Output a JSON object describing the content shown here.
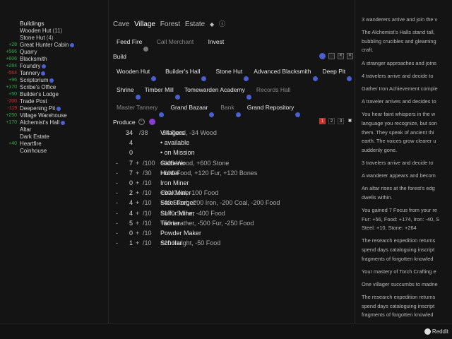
{
  "left_rates": [
    {
      "text": "+28",
      "cls": "pos"
    },
    {
      "text": "+566",
      "cls": "pos"
    },
    {
      "text": "+606",
      "cls": "pos"
    },
    {
      "text": "+284",
      "cls": "pos"
    },
    {
      "text": "-564",
      "cls": "neg"
    },
    {
      "text": "+96",
      "cls": "pos"
    },
    {
      "text": "+170",
      "cls": "pos"
    },
    {
      "text": "+50",
      "cls": "pos"
    },
    {
      "text": "-200",
      "cls": "neg"
    },
    {
      "text": "-119",
      "cls": "neg"
    },
    {
      "text": "+250",
      "cls": "pos"
    },
    {
      "text": "+170",
      "cls": "pos"
    },
    {
      "text": "",
      "cls": "pos"
    },
    {
      "text": "",
      "cls": "pos"
    },
    {
      "text": "+40",
      "cls": "pos"
    }
  ],
  "buildings": {
    "title": "Buildings",
    "items": [
      {
        "label": "Wooden Hut",
        "count": "(11)",
        "badge": false
      },
      {
        "label": "Stone Hut",
        "count": "(4)",
        "badge": false
      },
      {
        "label": "Great Hunter Cabin",
        "count": "",
        "badge": true
      },
      {
        "label": "Quarry",
        "count": "",
        "badge": false
      },
      {
        "label": "Blacksmith",
        "count": "",
        "badge": false
      },
      {
        "label": "Foundry",
        "count": "",
        "badge": true
      },
      {
        "label": "Tannery",
        "count": "",
        "badge": true
      },
      {
        "label": "Scriptorium",
        "count": "",
        "badge": true
      },
      {
        "label": "Scribe's Office",
        "count": "",
        "badge": false
      },
      {
        "label": "Builder's Lodge",
        "count": "",
        "badge": false
      },
      {
        "label": "Trade Post",
        "count": "",
        "badge": false
      },
      {
        "label": "Deepening Pit",
        "count": "",
        "badge": true
      },
      {
        "label": "Village Warehouse",
        "count": "",
        "badge": false
      },
      {
        "label": "Alchemist's Hall",
        "count": "",
        "badge": true
      },
      {
        "label": "Altar",
        "count": "",
        "badge": false
      },
      {
        "label": "Dark Estate",
        "count": "",
        "badge": false
      },
      {
        "label": "Heartfire",
        "count": "",
        "badge": false
      },
      {
        "label": "Coinhouse",
        "count": "",
        "badge": false
      }
    ]
  },
  "tabs": [
    "Cave",
    "Village",
    "Forest",
    "Estate"
  ],
  "active_tab": "Village",
  "actions": {
    "feed_fire": "Feed Fire",
    "call_merchant": "Call Merchant",
    "invest": "Invest"
  },
  "build": {
    "title": "Build",
    "row1": [
      "Wooden Hut",
      "Builder's Hall",
      "Stone Hut",
      "Advanced Blacksmith",
      "Deep Pit"
    ],
    "row2": [
      "Shrine",
      "Timber Mill",
      "Tomewarden Academy",
      "Records Hall"
    ],
    "row3": [
      "Master Tannery",
      "Grand Bazaar",
      "Bank",
      "Grand Repository"
    ]
  },
  "produce": {
    "title": "Produce",
    "pages": [
      "1",
      "2",
      "3"
    ],
    "villagers": {
      "count": "34",
      "cap": "/38",
      "label": "Villagers",
      "effect": "-34 Food, -34 Wood"
    },
    "available": {
      "count": "4",
      "label": "• available"
    },
    "mission": {
      "count": "0",
      "label": "• on Mission"
    },
    "jobs": [
      {
        "num": "7",
        "cap": "/100",
        "name": "Gatherer",
        "effect": "+600 Wood, +600 Stone"
      },
      {
        "num": "7",
        "cap": "/30",
        "name": "Hunter",
        "effect": "+600 Food, +120 Fur, +120 Bones"
      },
      {
        "num": "0",
        "cap": "/10",
        "name": "Iron Miner",
        "effect": ""
      },
      {
        "num": "2",
        "cap": "/10",
        "name": "Coal Miner",
        "effect": "+90 Coal, -100 Food"
      },
      {
        "num": "4",
        "cap": "/10",
        "name": "Steel Forger",
        "effect": "+40 Steel, -200 Iron, -200 Coal, -200 Food"
      },
      {
        "num": "4",
        "cap": "/10",
        "name": "Sulfur Miner",
        "effect": "+170 Sulfur, -400 Food"
      },
      {
        "num": "5",
        "cap": "/10",
        "name": "Tanner",
        "effect": "+50 Leather, -500 Fur, -250 Food"
      },
      {
        "num": "0",
        "cap": "/10",
        "name": "Powder Maker",
        "effect": ""
      },
      {
        "num": "1",
        "cap": "/10",
        "name": "Scholar",
        "effect": "+20 Insight, -50 Food"
      }
    ]
  },
  "log": [
    [
      "3 wanderers arrive and join the v"
    ],
    [
      "The Alchemist's Halls stand tall,",
      "bubbling crucibles and gleaming",
      "craft."
    ],
    [
      "A stranger approaches and joins"
    ],
    [
      "4 travelers arrive and decide to"
    ],
    [
      "Gather Iron Achievement comple"
    ],
    [
      "A traveler arrives and decides to"
    ],
    [
      "You hear faint whispers in the w",
      "language you recognize, but son",
      "them. They speak of ancient thi",
      "earth. The voices grow clearer u",
      "suddenly gone."
    ],
    [
      "3 travelers arrive and decide to"
    ],
    [
      "A wanderer appears and becom"
    ],
    [
      "An altar rises at the forest's edg",
      "dwells within."
    ],
    [
      "You gained 7 Focus from your re",
      "Fur: +56, Food: +174, Iron: -40, S",
      "Steel: +10, Stone: +264"
    ],
    [
      "The research expedition returns",
      "spend days cataloguing inscript",
      "fragments of forgotten knowled"
    ],
    [
      "Your mastery of Torch Crafting e"
    ],
    [
      "One villager succumbs to madne"
    ],
    [
      "The research expedition returns",
      "spend days cataloguing inscript",
      "fragments of forgotten knowled"
    ]
  ],
  "footer": {
    "reddit": "Reddit"
  },
  "colors": {
    "accent": "#4b5fd1",
    "positive": "#3aa84a",
    "negative": "#c0392b",
    "page_active": "#c9302c"
  }
}
